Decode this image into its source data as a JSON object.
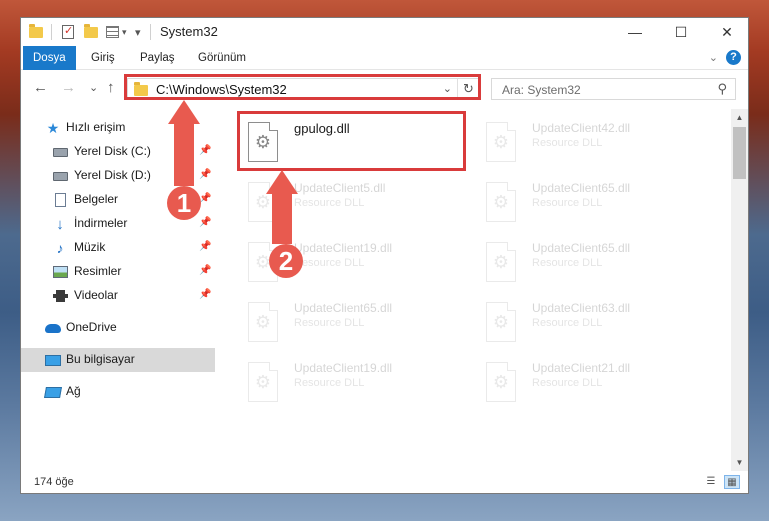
{
  "window": {
    "title": "System32",
    "minimize_glyph": "—",
    "maximize_glyph": "☐",
    "close_glyph": "✕"
  },
  "ribbon": {
    "tabs": [
      "Dosya",
      "Giriş",
      "Paylaş",
      "Görünüm"
    ],
    "active_tab": "Dosya",
    "help_glyph": "?",
    "collapse_glyph": "⌄"
  },
  "navigation": {
    "back_glyph": "←",
    "forward_glyph": "→",
    "recent_glyph": "⌄",
    "up_glyph": "↑",
    "address": "C:\\Windows\\System32",
    "address_dropdown_glyph": "⌄",
    "refresh_glyph": "↻",
    "search_placeholder": "Ara: System32",
    "search_glyph": "⚲"
  },
  "sidebar": {
    "items": [
      {
        "label": "Hızlı erişim",
        "icon": "star-icon",
        "pinned": false
      },
      {
        "label": "Yerel Disk (C:)",
        "icon": "drive-icon",
        "pinned": true
      },
      {
        "label": "Yerel Disk (D:)",
        "icon": "drive-icon",
        "pinned": true
      },
      {
        "label": "Belgeler",
        "icon": "documents-icon",
        "pinned": true
      },
      {
        "label": "İndirmeler",
        "icon": "downloads-icon",
        "pinned": true
      },
      {
        "label": "Müzik",
        "icon": "music-icon",
        "pinned": true
      },
      {
        "label": "Resimler",
        "icon": "pictures-icon",
        "pinned": true
      },
      {
        "label": "Videolar",
        "icon": "videos-icon",
        "pinned": true
      },
      {
        "label": "OneDrive",
        "icon": "onedrive-icon",
        "pinned": false
      },
      {
        "label": "Bu bilgisayar",
        "icon": "this-pc-icon",
        "pinned": false,
        "selected": true
      },
      {
        "label": "Ağ",
        "icon": "network-icon",
        "pinned": false
      }
    ],
    "pin_glyph": "📌"
  },
  "files": [
    {
      "name": "gpulog.dll",
      "type": "",
      "highlighted": true
    },
    {
      "name": "UpdateClient42.dll",
      "type": "Resource DLL"
    },
    {
      "name": "UpdateClient5.dll",
      "type": "Resource DLL"
    },
    {
      "name": "UpdateClient65.dll",
      "type": "Resource DLL"
    },
    {
      "name": "UpdateClient19.dll",
      "type": "Resource DLL"
    },
    {
      "name": "UpdateClient65.dll",
      "type": "Resource DLL"
    },
    {
      "name": "UpdateClient65.dll",
      "type": "Resource DLL"
    },
    {
      "name": "UpdateClient63.dll",
      "type": "Resource DLL"
    },
    {
      "name": "UpdateClient19.dll",
      "type": "Resource DLL"
    },
    {
      "name": "UpdateClient21.dll",
      "type": "Resource DLL"
    }
  ],
  "status": {
    "count": "174 öğe"
  },
  "annotations": {
    "step1": "1",
    "step2": "2",
    "color": "#e85a4f",
    "box_color": "#d93b3b"
  }
}
